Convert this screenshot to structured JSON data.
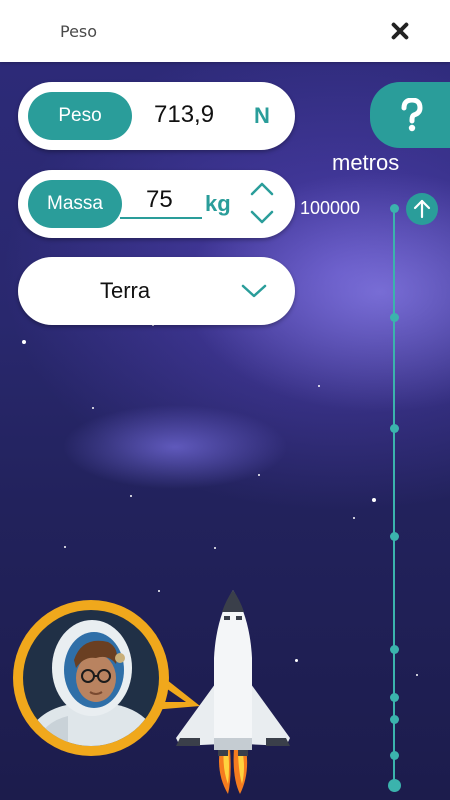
{
  "header": {
    "title": "Peso",
    "close_icon": "close-icon"
  },
  "weight": {
    "label": "Peso",
    "value": "713,9",
    "unit": "N"
  },
  "mass": {
    "label": "Massa",
    "value": "75",
    "unit": "kg"
  },
  "planet": {
    "selected": "Terra"
  },
  "help": {
    "label": "?"
  },
  "altitude": {
    "unit_label": "metros",
    "top_value": "100000"
  },
  "colors": {
    "accent": "#2a9d9a",
    "scale": "#3bb3ad",
    "badge_ring": "#f0a81c",
    "space": "#2d2a78"
  }
}
